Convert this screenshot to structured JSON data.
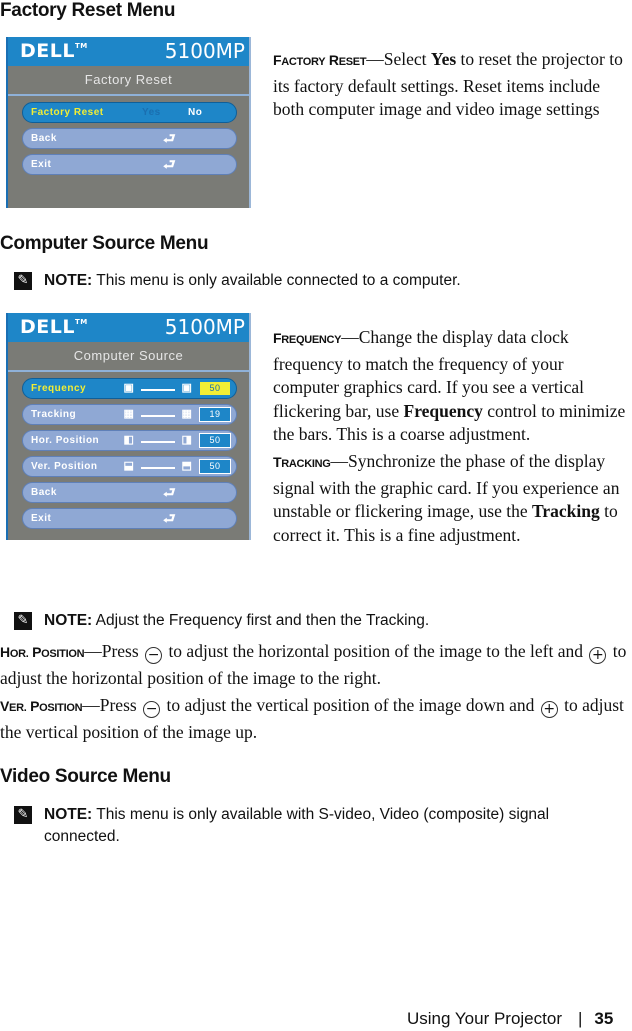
{
  "sections": {
    "factory_reset": {
      "heading": "Factory Reset Menu",
      "osd": {
        "logo": "DELL",
        "trademark": "TM",
        "model": "5100MP",
        "title": "Factory Reset",
        "rows": [
          {
            "label": "Factory Reset",
            "option_yes": "Yes",
            "option_no": "No",
            "selected": true
          },
          {
            "label": "Back",
            "icon": "enter-icon"
          },
          {
            "label": "Exit",
            "icon": "enter-icon"
          }
        ]
      },
      "description": {
        "term": "Factory Reset",
        "term_first": "F",
        "term_rest": "ACTORY",
        "term2_first": "R",
        "term2_rest": "ESET",
        "dash": "—",
        "text_before": "Select ",
        "bold": "Yes",
        "text_after": " to reset the projector to its factory default settings. Reset items include both computer image and video image settings"
      }
    },
    "computer_source": {
      "heading": "Computer Source Menu",
      "note": {
        "label": "NOTE:",
        "text": " This menu is only available connected to a computer."
      },
      "osd": {
        "logo": "DELL",
        "trademark": "TM",
        "model": "5100MP",
        "title": "Computer Source",
        "rows": [
          {
            "label": "Frequency",
            "value": "50",
            "selected": true
          },
          {
            "label": "Tracking",
            "value": "19"
          },
          {
            "label": "Hor. Position",
            "value": "50"
          },
          {
            "label": "Ver. Position",
            "value": "50"
          },
          {
            "label": "Back",
            "icon": "enter-icon"
          },
          {
            "label": "Exit",
            "icon": "enter-icon"
          }
        ]
      },
      "frequency": {
        "term_first": "F",
        "term_rest": "REQUENCY",
        "dash": "—",
        "text_before": "Change the display data clock frequency to match the frequency of your computer graphics card. If you see a vertical flickering bar, use ",
        "bold": "Frequency",
        "text_after": " control to minimize the bars. This is a coarse adjustment."
      },
      "tracking": {
        "term_first": "T",
        "term_rest": "RACKING",
        "dash": "—",
        "text_before": "Synchronize the phase of the display signal with the graphic card. If you experience an unstable or flickering image, use the ",
        "bold": "Tracking",
        "text_after": " to correct it. This is a fine adjustment."
      },
      "note2": {
        "label": "NOTE:",
        "t1": " Adjust the ",
        "b1": "Frequency",
        "t2": " first and then the ",
        "b2": "Tracking",
        "t3": "."
      },
      "hor_position": {
        "term_first": "H",
        "term_rest": "OR.",
        "term2_first": "P",
        "term2_rest": "OSITION",
        "dash": "—",
        "t1": "Press ",
        "minus": "−",
        "t2": " to adjust the horizontal position of the image to the left and ",
        "plus": "+",
        "t3": " to adjust the horizontal position of the image to the right."
      },
      "ver_position": {
        "term_first": "V",
        "term_rest": "ER.",
        "term2_first": "P",
        "term2_rest": "OSITION",
        "dash": "—",
        "t1": "Press ",
        "minus": "−",
        "t2": " to adjust the vertical position of the image down and ",
        "plus": "+",
        "t3": " to adjust the vertical position of the image up."
      }
    },
    "video_source": {
      "heading": "Video Source Menu",
      "note": {
        "label": "NOTE:",
        "text": " This menu is only available with S-video, Video (composite) signal connected."
      }
    }
  },
  "footer": {
    "chapter": "Using Your Projector",
    "separator": "|",
    "page": "35"
  },
  "icons": {
    "enter": "⮐",
    "pencil": "✎"
  }
}
